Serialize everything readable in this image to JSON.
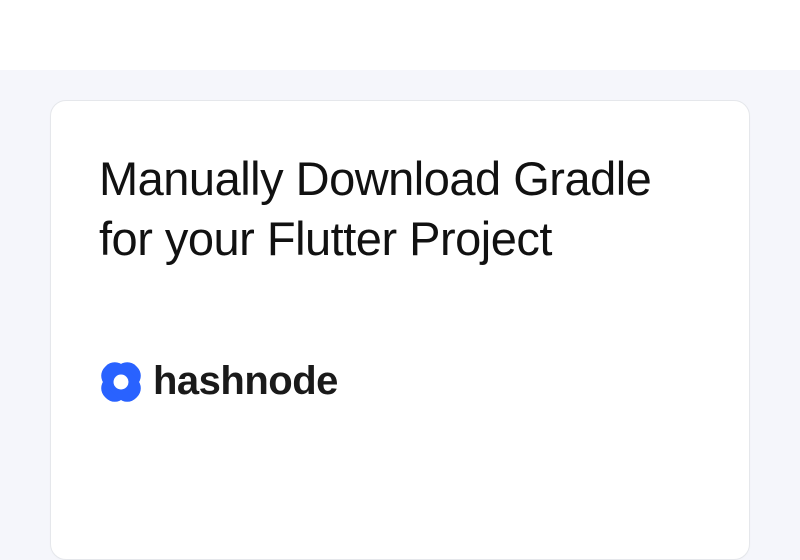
{
  "card": {
    "title": "Manually Download Gradle for your Flutter Project"
  },
  "brand": {
    "name": "hashnode",
    "logo_color": "#2962ff"
  }
}
